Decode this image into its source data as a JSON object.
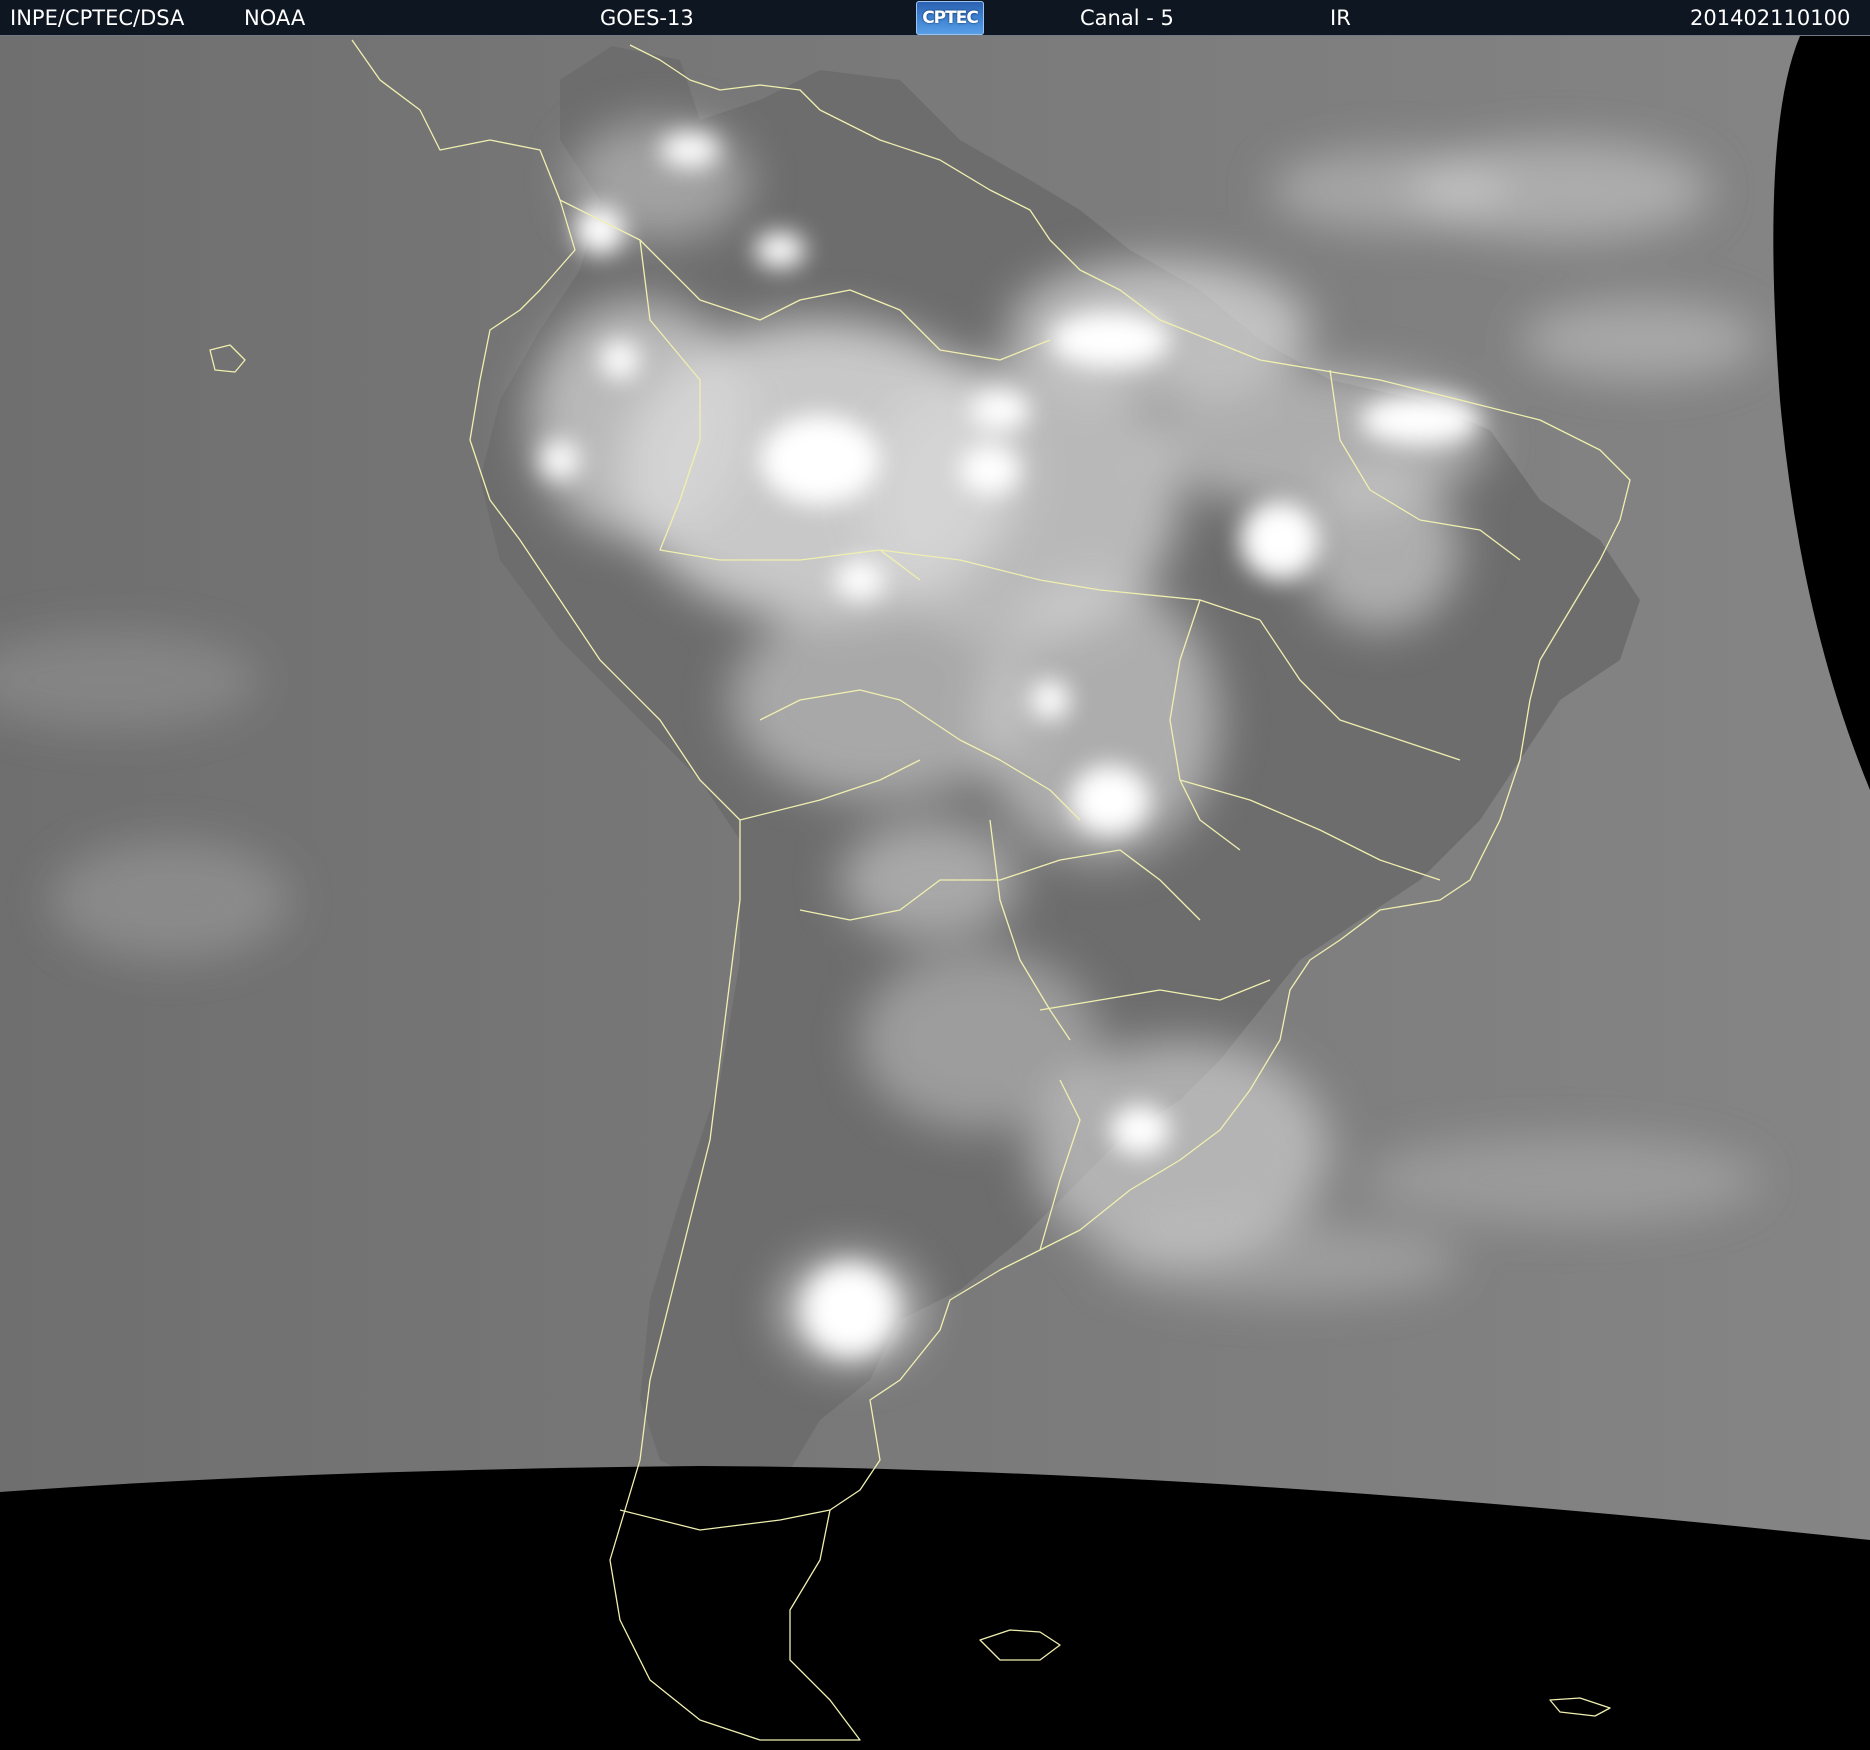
{
  "header": {
    "agency": "INPE/CPTEC/DSA",
    "source": "NOAA",
    "satellite": "GOES-13",
    "logo_text": "CPTEC",
    "channel": "Canal - 5",
    "band": "IR",
    "timestamp": "201402110100"
  },
  "colors": {
    "header_bg": "#0e1621",
    "ocean_gray": "#7a7a7a",
    "land_gray": "#6a6a6a",
    "cloud_white": "#f4f4f4",
    "boundary_yellow": "#f0efb0",
    "space_black": "#000000"
  },
  "icons": [
    "cptec-logo"
  ]
}
